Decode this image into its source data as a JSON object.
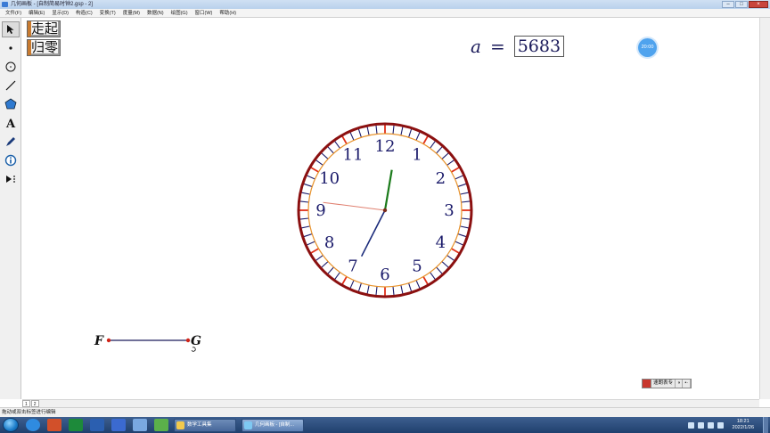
{
  "window": {
    "title": "几何画板 - [自制简易时钟2.gsp - 2]",
    "controls": [
      "–",
      "□",
      "×"
    ]
  },
  "menu": [
    "文件(F)",
    "编辑(E)",
    "显示(D)",
    "构造(C)",
    "变换(T)",
    "度量(M)",
    "数据(N)",
    "绘图(G)",
    "窗口(W)",
    "帮助(H)"
  ],
  "tools": [
    "arrow-select-tool",
    "point-tool",
    "compass-tool",
    "straightedge-tool",
    "polygon-tool",
    "text-tool",
    "marker-tool",
    "information-tool",
    "custom-tools"
  ],
  "buttons": {
    "go": "走起",
    "reset": "归零"
  },
  "parameter": {
    "name": "a",
    "equals": "=",
    "value": "5683"
  },
  "time_bubble": "20:00",
  "clock": {
    "numbers": [
      "12",
      "1",
      "2",
      "3",
      "4",
      "5",
      "6",
      "7",
      "8",
      "9",
      "10",
      "11"
    ],
    "hands": {
      "hour": {
        "minutes_angle": 1.6,
        "color": "#1a7a1a"
      },
      "minute": {
        "minutes_angle": 34.5,
        "color": "#1a2a7a"
      },
      "second": {
        "minutes_angle": 46.2,
        "color": "#e08070"
      }
    },
    "colors": {
      "rim": "#8b1010",
      "inner_ring": "#e8922a",
      "tick": "#1a1a6a",
      "hour_tick": "#e0301a",
      "numbers": "#1a1a6a"
    }
  },
  "segment": {
    "start_label": "F",
    "end_label": "G"
  },
  "page_tabs": [
    "1",
    "2"
  ],
  "status_bar": "拖动或双击标签进行编辑",
  "ime_bar": [
    "速朗表专",
    "◑",
    "•·"
  ],
  "taskbar": {
    "tasks": [
      {
        "label": "数学工具集",
        "active": false
      },
      {
        "label": "几何画板 - [自制...",
        "active": true
      }
    ],
    "time": "18:21",
    "date": "2022/1/26"
  }
}
